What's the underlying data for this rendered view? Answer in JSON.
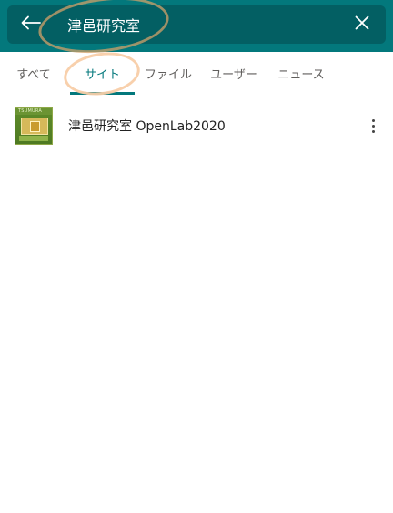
{
  "search": {
    "query": "津邑研究室",
    "back_icon": "arrow-left-icon",
    "clear_icon": "close-icon"
  },
  "tabs": [
    {
      "label": "すべて",
      "active": false
    },
    {
      "label": "サイト",
      "active": true
    },
    {
      "label": "ファイル",
      "active": false
    },
    {
      "label": "ユーザー",
      "active": false
    },
    {
      "label": "ニュース",
      "active": false
    }
  ],
  "results": [
    {
      "title": "津邑研究室 OpenLab2020",
      "logo_icon": "site-logo-icon",
      "menu_icon": "more-vertical-icon"
    }
  ],
  "colors": {
    "header": "#03787c",
    "search_bar": "#035f63",
    "accent": "#03787c",
    "annotation": "#f8cda8"
  }
}
